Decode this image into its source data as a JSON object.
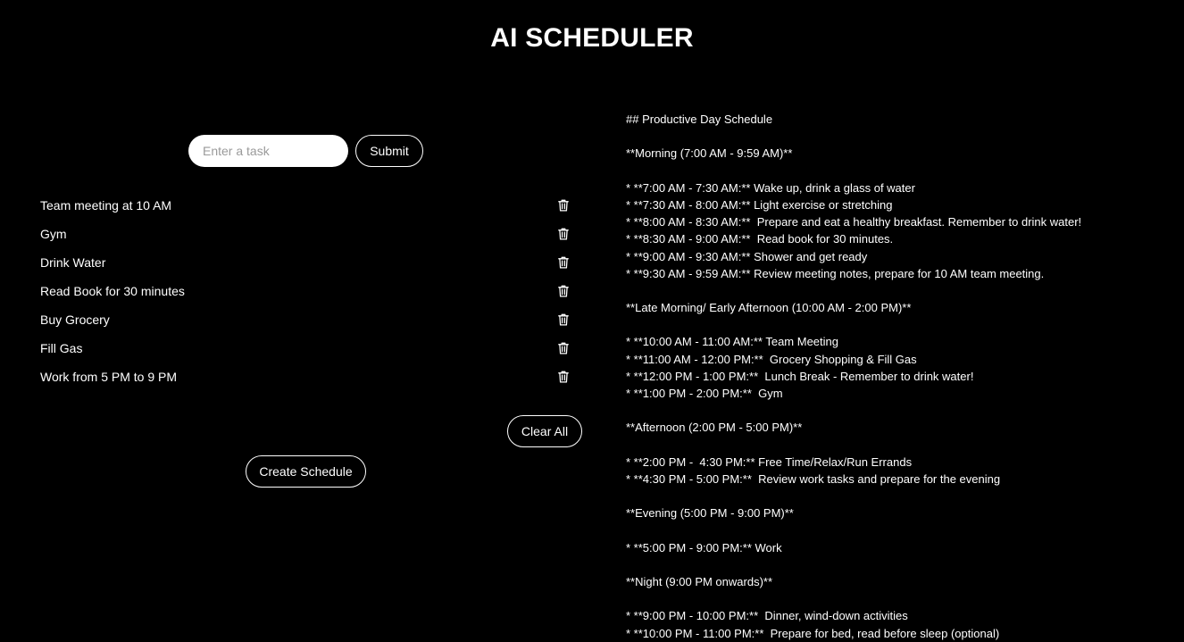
{
  "app": {
    "title": "AI SCHEDULER"
  },
  "task_form": {
    "input_placeholder": "Enter a task",
    "input_value": "",
    "submit_label": "Submit"
  },
  "tasks": [
    {
      "label": "Team meeting at 10 AM",
      "icon": "trash-icon"
    },
    {
      "label": "Gym",
      "icon": "trash-icon"
    },
    {
      "label": "Drink Water",
      "icon": "trash-icon"
    },
    {
      "label": "Read Book for 30 minutes",
      "icon": "trash-icon"
    },
    {
      "label": "Buy Grocery",
      "icon": "trash-icon"
    },
    {
      "label": "Fill Gas",
      "icon": "trash-icon"
    },
    {
      "label": "Work from 5 PM to 9 PM",
      "icon": "trash-icon"
    }
  ],
  "actions": {
    "clear_all_label": "Clear All",
    "create_schedule_label": "Create Schedule"
  },
  "schedule_lines": [
    "## Productive Day Schedule",
    "",
    "**Morning (7:00 AM - 9:59 AM)**",
    "",
    "* **7:00 AM - 7:30 AM:** Wake up, drink a glass of water",
    "* **7:30 AM - 8:00 AM:** Light exercise or stretching",
    "* **8:00 AM - 8:30 AM:**  Prepare and eat a healthy breakfast. Remember to drink water!",
    "* **8:30 AM - 9:00 AM:**  Read book for 30 minutes.",
    "* **9:00 AM - 9:30 AM:** Shower and get ready",
    "* **9:30 AM - 9:59 AM:** Review meeting notes, prepare for 10 AM team meeting.",
    "",
    "**Late Morning/ Early Afternoon (10:00 AM - 2:00 PM)**",
    "",
    "* **10:00 AM - 11:00 AM:** Team Meeting",
    "* **11:00 AM - 12:00 PM:**  Grocery Shopping & Fill Gas",
    "* **12:00 PM - 1:00 PM:**  Lunch Break - Remember to drink water!",
    "* **1:00 PM - 2:00 PM:**  Gym",
    "",
    "**Afternoon (2:00 PM - 5:00 PM)**",
    "",
    "* **2:00 PM -  4:30 PM:** Free Time/Relax/Run Errands",
    "* **4:30 PM - 5:00 PM:**  Review work tasks and prepare for the evening",
    "",
    "**Evening (5:00 PM - 9:00 PM)**",
    "",
    "* **5:00 PM - 9:00 PM:** Work",
    "",
    "**Night (9:00 PM onwards)**",
    "",
    "* **9:00 PM - 10:00 PM:**  Dinner, wind-down activities",
    "* **10:00 PM - 11:00 PM:**  Prepare for bed, read before sleep (optional)"
  ]
}
